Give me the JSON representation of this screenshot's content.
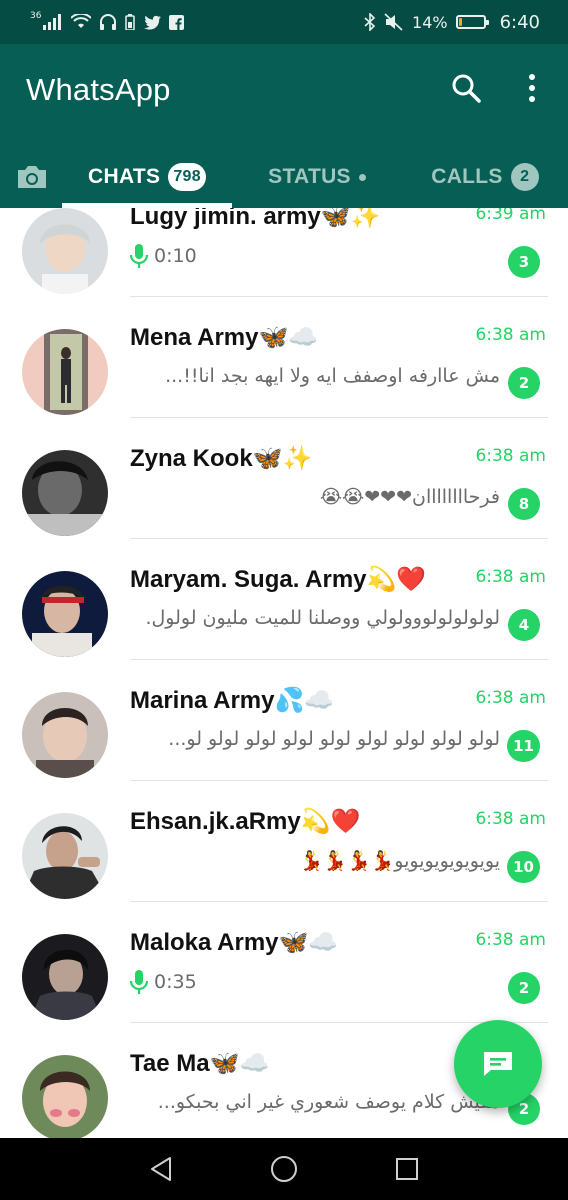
{
  "status_bar": {
    "network": "36",
    "battery_percent": "14%",
    "battery_level": 0.14,
    "time": "6:40",
    "icons": [
      "signal-icon",
      "wifi-icon",
      "headphones-icon",
      "battery-saver-icon",
      "twitter-icon",
      "facebook-icon",
      "bluetooth-icon",
      "mute-icon",
      "battery-icon"
    ]
  },
  "header": {
    "title": "WhatsApp",
    "colors": {
      "primary": "#075e54",
      "accent": "#25d366",
      "tab_inactive": "#9fc6bf"
    }
  },
  "tabs": {
    "camera_icon": "camera-icon",
    "chats": {
      "label": "CHATS",
      "badge": "798"
    },
    "status": {
      "label": "STATUS"
    },
    "calls": {
      "label": "CALLS",
      "badge": "2"
    }
  },
  "chats": [
    {
      "name": "Lugy jimin. army🦋✨",
      "time": "6:39 am",
      "preview": "0:10",
      "preview_type": "voice",
      "unread": "3"
    },
    {
      "name": "Mena Army🦋☁️",
      "time": "6:38 am",
      "preview": "مش عاارفه اوصفف ايه ولا ايهه بجد انا!!...",
      "preview_type": "text",
      "unread": "2"
    },
    {
      "name": "Zyna Kook🦋✨",
      "time": "6:38 am",
      "preview": "فرحاااااااان❤❤❤😭😭",
      "preview_type": "text",
      "unread": "8"
    },
    {
      "name": "Maryam. Suga. Army💫❤️",
      "time": "6:38 am",
      "preview": "لولولولولووولولي ووصلنا للميت مليون لولول.",
      "preview_type": "text",
      "unread": "4"
    },
    {
      "name": "Marina Army💦☁️",
      "time": "6:38 am",
      "preview": "لولو لولو لولو لولو لولو لولو لولو لولو لو...",
      "preview_type": "text",
      "unread": "11"
    },
    {
      "name": "Ehsan.jk.aRmy💫❤️",
      "time": "6:38 am",
      "preview": "يويويويويويويو💃💃💃💃",
      "preview_type": "text",
      "unread": "10"
    },
    {
      "name": "Maloka Army🦋☁️",
      "time": "6:38 am",
      "preview": "0:35",
      "preview_type": "voice",
      "unread": "2"
    },
    {
      "name": "Tae Ma🦋☁️",
      "time": "",
      "preview": "مفيش كلام يوصف شعوري غير اني بحبكو...",
      "preview_type": "text",
      "unread": "2"
    }
  ],
  "fab": {
    "icon": "new-chat-icon"
  },
  "nav": {
    "back_icon": "back-icon",
    "home_icon": "home-icon",
    "recents_icon": "recents-icon"
  }
}
